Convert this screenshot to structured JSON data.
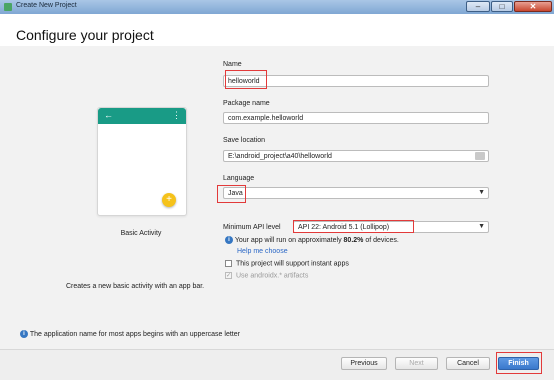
{
  "window": {
    "title": "Create New Project"
  },
  "header": {
    "title": "Configure your project"
  },
  "template": {
    "label": "Basic Activity",
    "description": "Creates a new basic activity with an app bar."
  },
  "form": {
    "name_label": "Name",
    "name_value": "helloworld",
    "package_label": "Package name",
    "package_value": "com.example.helloworld",
    "save_label": "Save location",
    "save_value": "E:\\android_project\\a40\\helloworld",
    "language_label": "Language",
    "language_value": "Java",
    "api_label": "Minimum API level",
    "api_value": "API 22: Android 5.1 (Lollipop)",
    "api_info_prefix": "Your app will run on approximately ",
    "api_info_percent": "80.2%",
    "api_info_suffix": " of devices.",
    "help_link": "Help me choose",
    "instant_apps_label": "This project will support instant apps",
    "instant_apps_checked": false,
    "androidx_label": "Use androidx.* artifacts",
    "androidx_checked": true
  },
  "bottom_info": "The application name for most apps begins with an uppercase letter",
  "footer": {
    "previous": "Previous",
    "next": "Next",
    "cancel": "Cancel",
    "finish": "Finish"
  },
  "colors": {
    "app_bar": "#199b86",
    "fab": "#f5c21b",
    "highlight": "#e23a3a",
    "primary_button": "#3a78cc"
  }
}
